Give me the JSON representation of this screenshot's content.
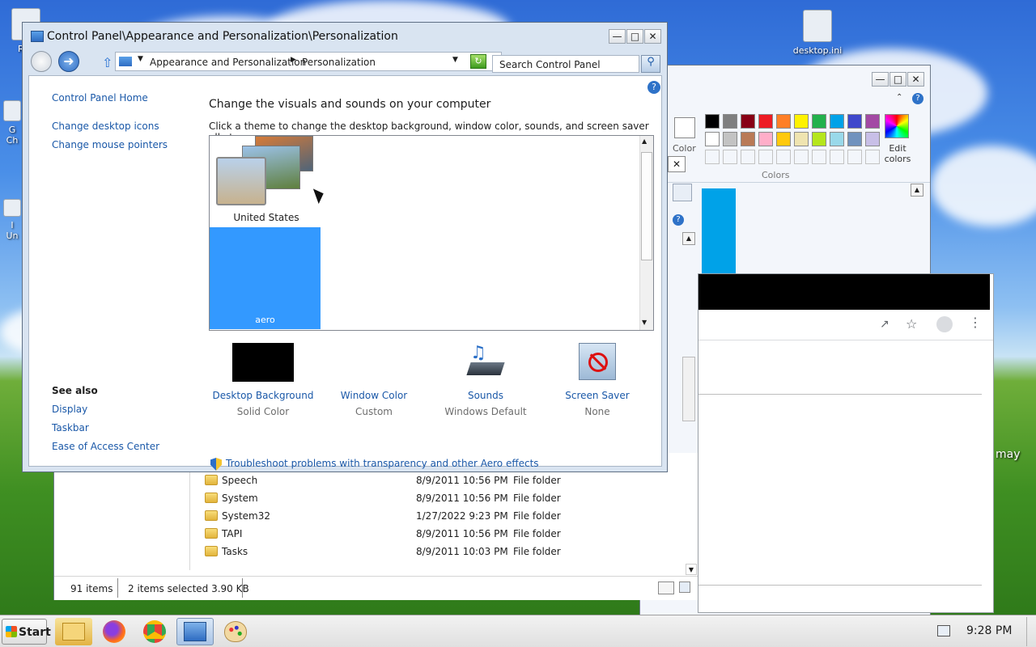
{
  "desktop": {
    "icons": [
      {
        "label": "Rec"
      },
      {
        "label": "desktop.ini"
      },
      {
        "label": "G"
      },
      {
        "label": "Ch"
      },
      {
        "label": "I"
      },
      {
        "label": "Un"
      }
    ],
    "right_edge_text": "may"
  },
  "control_panel": {
    "title": "Control Panel\\Appearance and Personalization\\Personalization",
    "breadcrumb": [
      "Appearance and Personalization",
      "Personalization"
    ],
    "search_placeholder": "Search Control Panel",
    "sidebar": {
      "home": "Control Panel Home",
      "links": [
        "Change desktop icons",
        "Change mouse pointers"
      ],
      "see_also_heading": "See also",
      "see_also": [
        "Display",
        "Taskbar",
        "Ease of Access Center"
      ]
    },
    "heading": "Change the visuals and sounds on your computer",
    "subheading": "Click a theme to change the desktop background, window color, sounds, and screen saver all at once.",
    "themes": [
      {
        "label": "United States"
      },
      {
        "label": "aero"
      }
    ],
    "settings": [
      {
        "label": "Desktop Background",
        "value": "Solid Color"
      },
      {
        "label": "Window Color",
        "value": "Custom"
      },
      {
        "label": "Sounds",
        "value": "Windows Default"
      },
      {
        "label": "Screen Saver",
        "value": "None"
      }
    ],
    "troubleshoot": "Troubleshoot problems with transparency and other Aero effects"
  },
  "paint": {
    "color_label": "Color",
    "colors_group": "Colors",
    "edit_colors": "Edit colors",
    "palette_row1": [
      "#000000",
      "#7f7f7f",
      "#880015",
      "#ed1c24",
      "#ff7f27",
      "#fff200",
      "#22b14c",
      "#00a2e8",
      "#3f48cc",
      "#a349a4"
    ],
    "palette_row2": [
      "#ffffff",
      "#c3c3c3",
      "#b97a57",
      "#ffaec9",
      "#ffc90e",
      "#efe4b0",
      "#b5e61d",
      "#99d9ea",
      "#7092be",
      "#c8bfe7"
    ]
  },
  "explorer": {
    "rows": [
      {
        "name": "Speech",
        "date": "8/9/2011 10:56 PM",
        "type": "File folder"
      },
      {
        "name": "System",
        "date": "8/9/2011 10:56 PM",
        "type": "File folder"
      },
      {
        "name": "System32",
        "date": "1/27/2022 9:23 PM",
        "type": "File folder"
      },
      {
        "name": "TAPI",
        "date": "8/9/2011 10:56 PM",
        "type": "File folder"
      },
      {
        "name": "Tasks",
        "date": "8/9/2011 10:03 PM",
        "type": "File folder"
      }
    ],
    "status_items": "91 items",
    "status_selected": "2 items selected  3.90 KB"
  },
  "taskbar": {
    "start_label": "Start",
    "clock": "9:28 PM",
    "apps": [
      "file-explorer-icon",
      "firefox-icon",
      "chrome-icon",
      "control-panel-icon",
      "paint-icon"
    ]
  }
}
